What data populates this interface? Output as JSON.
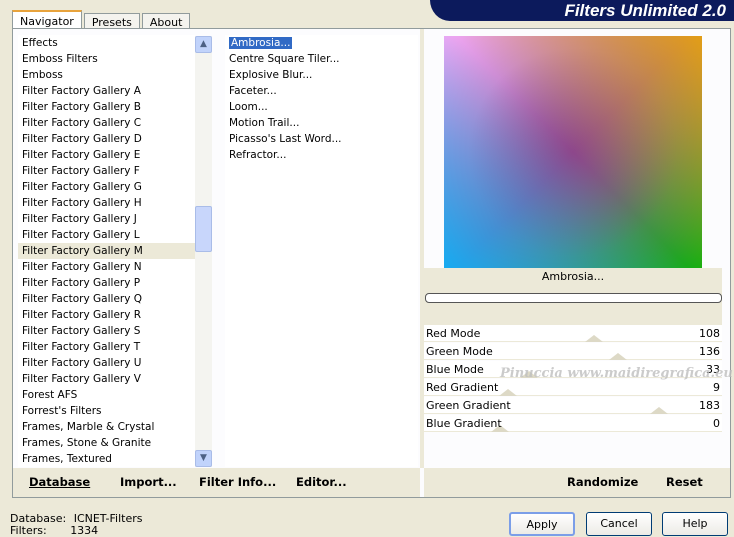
{
  "title": "Filters Unlimited 2.0",
  "tabs": [
    {
      "label": "Navigator",
      "active": true
    },
    {
      "label": "Presets"
    },
    {
      "label": "About"
    }
  ],
  "categories": [
    "Effects",
    "Emboss Filters",
    "Emboss",
    "Filter Factory Gallery A",
    "Filter Factory Gallery B",
    "Filter Factory Gallery C",
    "Filter Factory Gallery D",
    "Filter Factory Gallery E",
    "Filter Factory Gallery F",
    "Filter Factory Gallery G",
    "Filter Factory Gallery H",
    "Filter Factory Gallery J",
    "Filter Factory Gallery L",
    "Filter Factory Gallery M",
    "Filter Factory Gallery N",
    "Filter Factory Gallery P",
    "Filter Factory Gallery Q",
    "Filter Factory Gallery R",
    "Filter Factory Gallery S",
    "Filter Factory Gallery T",
    "Filter Factory Gallery U",
    "Filter Factory Gallery V",
    "Forest AFS",
    "Forrest's Filters",
    "Frames, Marble & Crystal",
    "Frames, Stone & Granite",
    "Frames, Textured"
  ],
  "selected_category": "Filter Factory Gallery M",
  "filters": [
    "Ambrosia...",
    "Centre Square Tiler...",
    "Explosive Blur...",
    "Faceter...",
    "Loom...",
    "Motion Trail...",
    "Picasso's Last Word...",
    "Refractor..."
  ],
  "selected_filter": "Ambrosia...",
  "preview_label": "Ambrosia...",
  "params": [
    {
      "label": "Red Mode",
      "value": 108
    },
    {
      "label": "Green Mode",
      "value": 136
    },
    {
      "label": "Blue Mode",
      "value": 33
    },
    {
      "label": "Red Gradient",
      "value": 9
    },
    {
      "label": "Green Gradient",
      "value": 183
    },
    {
      "label": "Blue Gradient",
      "value": 0
    }
  ],
  "watermark": "Pinuccia www.maidiregrafica.eu",
  "left_buttons": [
    "Database",
    "Import...",
    "Filter Info...",
    "Editor..."
  ],
  "right_buttons": [
    "Randomize",
    "Reset"
  ],
  "status": {
    "database_label": "Database:",
    "database_value": "ICNET-Filters",
    "filters_label": "Filters:",
    "filters_value": "1334"
  },
  "dialog_buttons": [
    "Apply",
    "Cancel",
    "Help"
  ]
}
